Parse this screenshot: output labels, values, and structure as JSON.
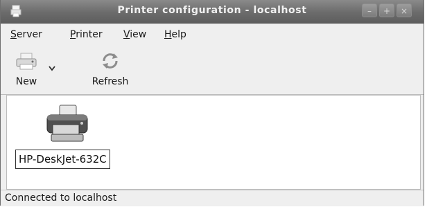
{
  "window": {
    "title": "Printer configuration - localhost",
    "controls": [
      "minimize-icon",
      "maximize-icon",
      "close-icon"
    ]
  },
  "menubar": {
    "items": [
      {
        "label_first": "S",
        "label_rest": "erver"
      },
      {
        "label_first": "P",
        "label_rest": "rinter"
      },
      {
        "label_first": "V",
        "label_rest": "iew"
      },
      {
        "label_first": "H",
        "label_rest": "elp"
      }
    ]
  },
  "toolbar": {
    "new_label": "New",
    "new_icon": "new-printer-icon",
    "dropdown_icon": "chevron-down-icon",
    "refresh_label": "Refresh",
    "refresh_icon": "refresh-icon"
  },
  "printers": [
    {
      "name": "HP-DeskJet-632C",
      "icon": "printer-icon"
    }
  ],
  "status": {
    "text": "Connected to localhost"
  },
  "colors": {
    "titlebar": "#6b6b6b",
    "title_text": "#f2f2f2",
    "window_bg": "#efefef",
    "content_bg": "#ffffff"
  }
}
